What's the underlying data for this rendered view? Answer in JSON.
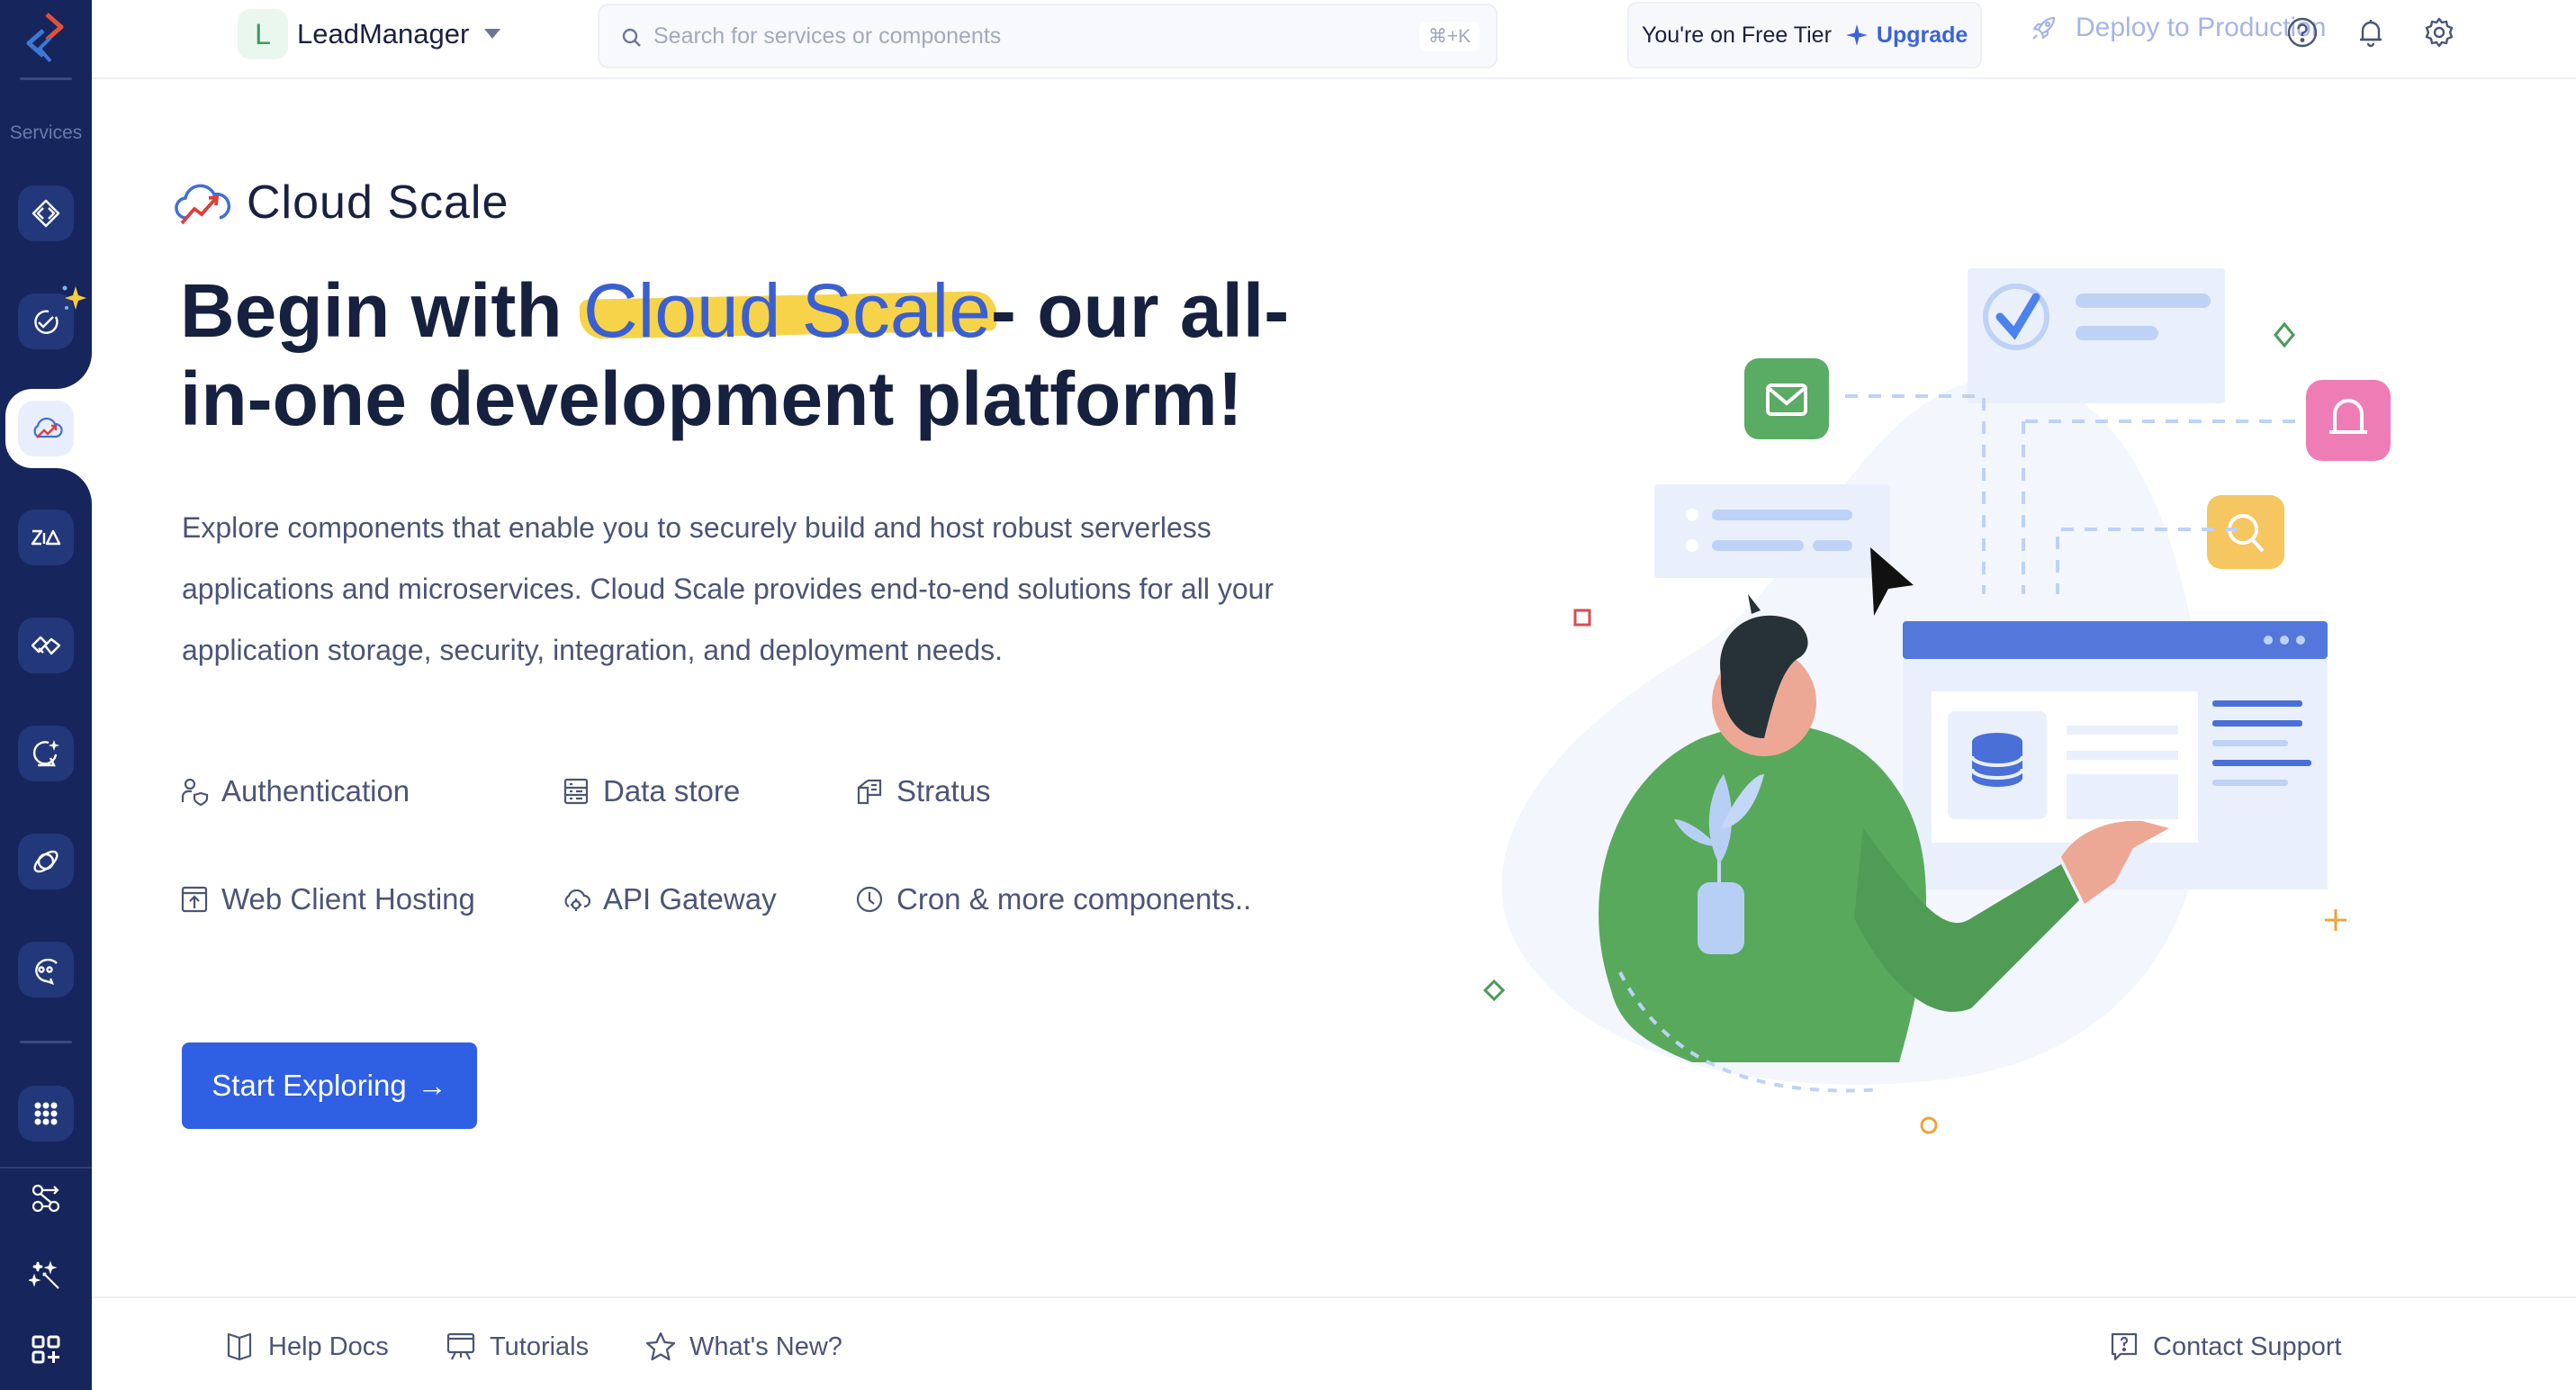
{
  "sidebar": {
    "section_label": "Services",
    "items": [
      {
        "name": "code-services-icon",
        "active": false
      },
      {
        "name": "ai-services-icon",
        "active": false
      },
      {
        "name": "cloud-scale-icon",
        "active": true
      },
      {
        "name": "zia-icon",
        "active": false
      },
      {
        "name": "integrations-icon",
        "active": false
      },
      {
        "name": "quickml-icon",
        "active": false
      },
      {
        "name": "orbit-icon",
        "active": false
      },
      {
        "name": "chat-bot-icon",
        "active": false
      }
    ],
    "bottom_items": [
      {
        "name": "all-apps-icon"
      },
      {
        "name": "workflow-icon"
      },
      {
        "name": "magic-wand-icon"
      },
      {
        "name": "add-widget-icon"
      }
    ]
  },
  "topbar": {
    "org_initial": "L",
    "org_name": "LeadManager",
    "search_placeholder": "Search for services or components",
    "search_shortcut": "⌘+K",
    "tier_text": "You're on Free Tier",
    "upgrade_label": "Upgrade",
    "deploy_label": "Deploy to Production",
    "colors": {
      "accent": "#3b63d8",
      "deploy_disabled": "#a6b4e6"
    }
  },
  "content": {
    "product_name": "Cloud Scale",
    "hero_prefix": "Begin with ",
    "hero_highlight": "Cloud Scale",
    "hero_suffix": "- our all-in-one development platform!",
    "description": "Explore components that enable you to securely build and host robust serverless applications and microservices. Cloud Scale provides end-to-end solutions for all your application storage, security, integration, and deployment needs.",
    "features": [
      {
        "label": "Authentication",
        "icon": "authentication-icon"
      },
      {
        "label": "Data store",
        "icon": "data-store-icon"
      },
      {
        "label": "Stratus",
        "icon": "stratus-icon"
      },
      {
        "label": "Web Client Hosting",
        "icon": "web-hosting-icon"
      },
      {
        "label": "API Gateway",
        "icon": "api-gateway-icon"
      },
      {
        "label": "Cron & more components..",
        "icon": "clock-icon"
      }
    ],
    "cta_label": "Start Exploring",
    "cta_arrow": "→",
    "colors": {
      "cta": "#2f5fe3",
      "highlight": "#f7d34a",
      "highlight_text": "#3a5fd0"
    }
  },
  "footer": {
    "links": [
      {
        "label": "Help Docs",
        "icon": "book-icon"
      },
      {
        "label": "Tutorials",
        "icon": "tutorial-board-icon"
      },
      {
        "label": "What's New?",
        "icon": "star-icon"
      }
    ],
    "support_label": "Contact Support"
  }
}
